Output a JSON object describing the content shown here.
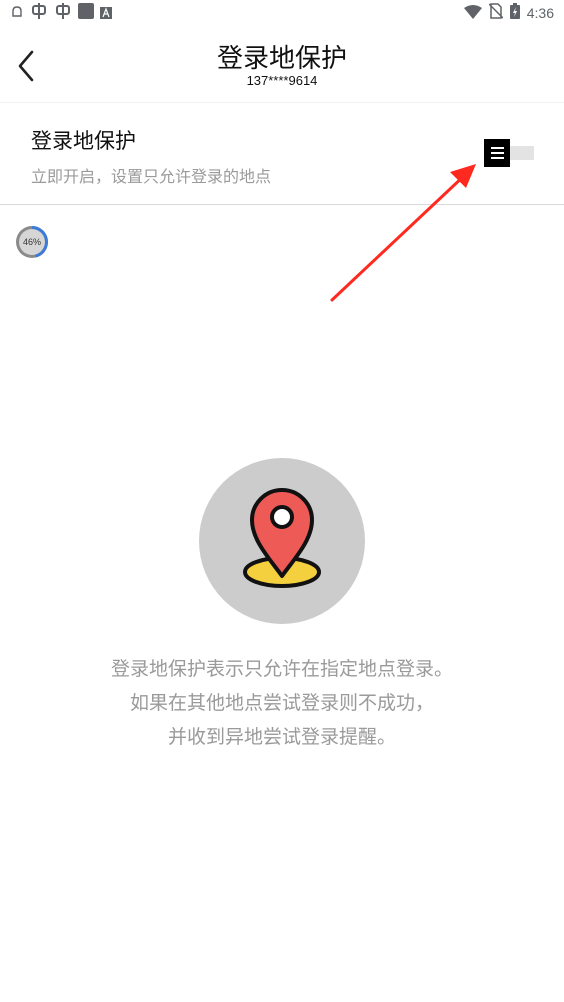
{
  "status_bar": {
    "time": "4:36",
    "icons": [
      "notification-icon",
      "bug-icon",
      "bug-icon",
      "app-square-icon",
      "a-badge-icon",
      "wifi-icon",
      "no-sim-icon",
      "battery-charging-icon"
    ]
  },
  "header": {
    "title": "登录地保护",
    "subtitle": "137****9614"
  },
  "setting": {
    "title": "登录地保护",
    "description": "立即开启，设置只允许登录的地点",
    "toggle_on": false
  },
  "progress": {
    "label": "46%",
    "value": 0.46
  },
  "empty_state": {
    "icon": "location-pin-icon",
    "lines": [
      "登录地保护表示只允许在指定地点登录。",
      "如果在其他地点尝试登录则不成功，",
      "并收到异地尝试登录提醒。"
    ]
  },
  "colors": {
    "pin": "#ee5b57",
    "pin_base": "#f4d03f",
    "circle": "#cccccc",
    "arrow": "#ff2a1f",
    "progress_ring": "#3d7bd9"
  }
}
